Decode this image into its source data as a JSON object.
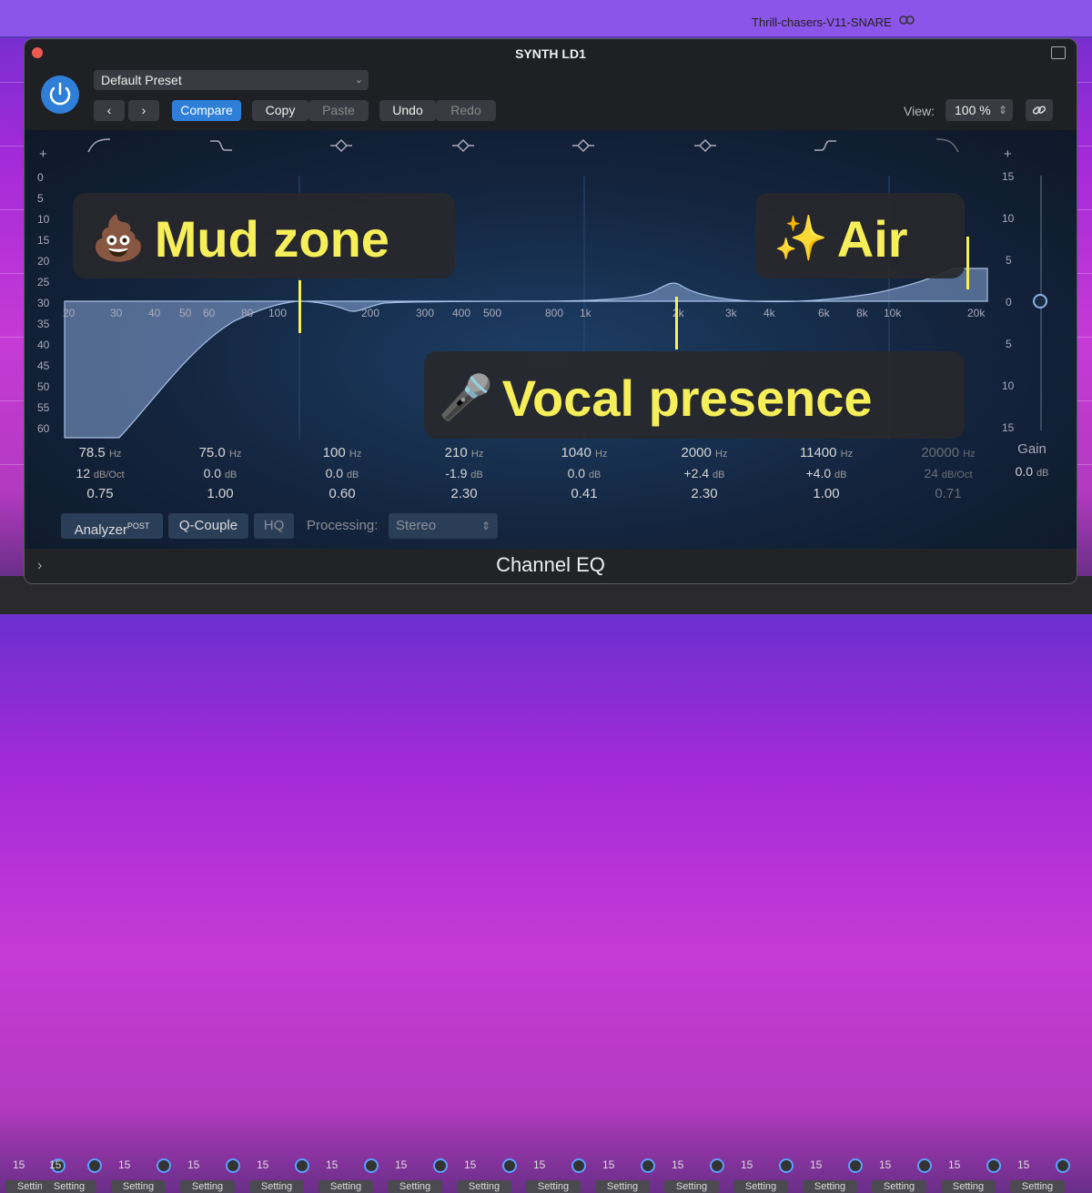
{
  "track_name": "Thrill-chasers-V11-SNARE",
  "window": {
    "title": "SYNTH LD1",
    "plugin_name": "Channel EQ"
  },
  "toolbar": {
    "preset": "Default Preset",
    "compare": "Compare",
    "copy": "Copy",
    "paste": "Paste",
    "undo": "Undo",
    "redo": "Redo",
    "view_label": "View:",
    "view_value": "100 %"
  },
  "left_axis": [
    "+",
    "0",
    "5",
    "10",
    "15",
    "20",
    "25",
    "30",
    "35",
    "40",
    "45",
    "50",
    "55",
    "60"
  ],
  "right_axis": [
    "+",
    "15",
    "10",
    "5",
    "0",
    "5",
    "10",
    "15"
  ],
  "freq_labels": [
    "20",
    "30",
    "40",
    "50",
    "60",
    "80",
    "100",
    "200",
    "300",
    "400",
    "500",
    "800",
    "1k",
    "2k",
    "3k",
    "4k",
    "6k",
    "8k",
    "10k",
    "20k"
  ],
  "bands": [
    {
      "freq": "78.5",
      "freq_unit": "Hz",
      "gain": "12",
      "gain_unit": "dB/Oct",
      "q": "0.75"
    },
    {
      "freq": "75.0",
      "freq_unit": "Hz",
      "gain": "0.0",
      "gain_unit": "dB",
      "q": "1.00"
    },
    {
      "freq": "100",
      "freq_unit": "Hz",
      "gain": "0.0",
      "gain_unit": "dB",
      "q": "0.60"
    },
    {
      "freq": "210",
      "freq_unit": "Hz",
      "gain": "-1.9",
      "gain_unit": "dB",
      "q": "2.30"
    },
    {
      "freq": "1040",
      "freq_unit": "Hz",
      "gain": "0.0",
      "gain_unit": "dB",
      "q": "0.41"
    },
    {
      "freq": "2000",
      "freq_unit": "Hz",
      "gain": "+2.4",
      "gain_unit": "dB",
      "q": "2.30"
    },
    {
      "freq": "11400",
      "freq_unit": "Hz",
      "gain": "+4.0",
      "gain_unit": "dB",
      "q": "1.00"
    },
    {
      "freq": "20000",
      "freq_unit": "Hz",
      "gain": "24",
      "gain_unit": "dB/Oct",
      "q": "0.71"
    }
  ],
  "gain": {
    "label": "Gain",
    "value": "0.0",
    "unit": "dB"
  },
  "bottom": {
    "analyzer": "Analyzer",
    "analyzer_sup": "POST",
    "qcouple": "Q-Couple",
    "hq": "HQ",
    "processing_label": "Processing:",
    "processing_value": "Stereo"
  },
  "callouts": {
    "mud": {
      "emoji": "💩",
      "text": "Mud zone"
    },
    "air": {
      "emoji": "✨",
      "text": "Air"
    },
    "vocal": {
      "emoji": "🎤",
      "text": "Vocal presence"
    }
  },
  "mixer_strips": {
    "value": "15",
    "setting": "Setting"
  },
  "colors": {
    "accent": "#2f7fd8",
    "callout_text": "#f7ef5a",
    "curve_fill": "#8aa8d8"
  }
}
